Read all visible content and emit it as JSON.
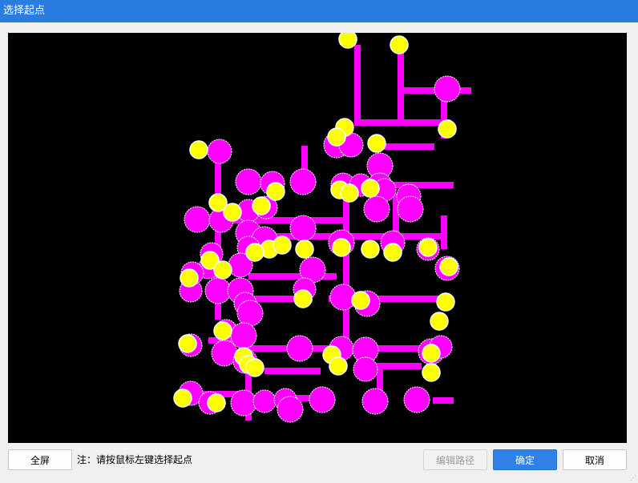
{
  "window": {
    "title": "选择起点"
  },
  "canvas": {
    "background": "#000000",
    "line_color": "#ff00ff",
    "node_color": "#ff00ff",
    "selected_color": "#ffff00"
  },
  "toolbar": {
    "fullscreen_label": "全屏",
    "hint": "注：请按鼠标左键选择起点",
    "edit_path_label": "编辑路径",
    "confirm_label": "确定",
    "cancel_label": "取消"
  }
}
